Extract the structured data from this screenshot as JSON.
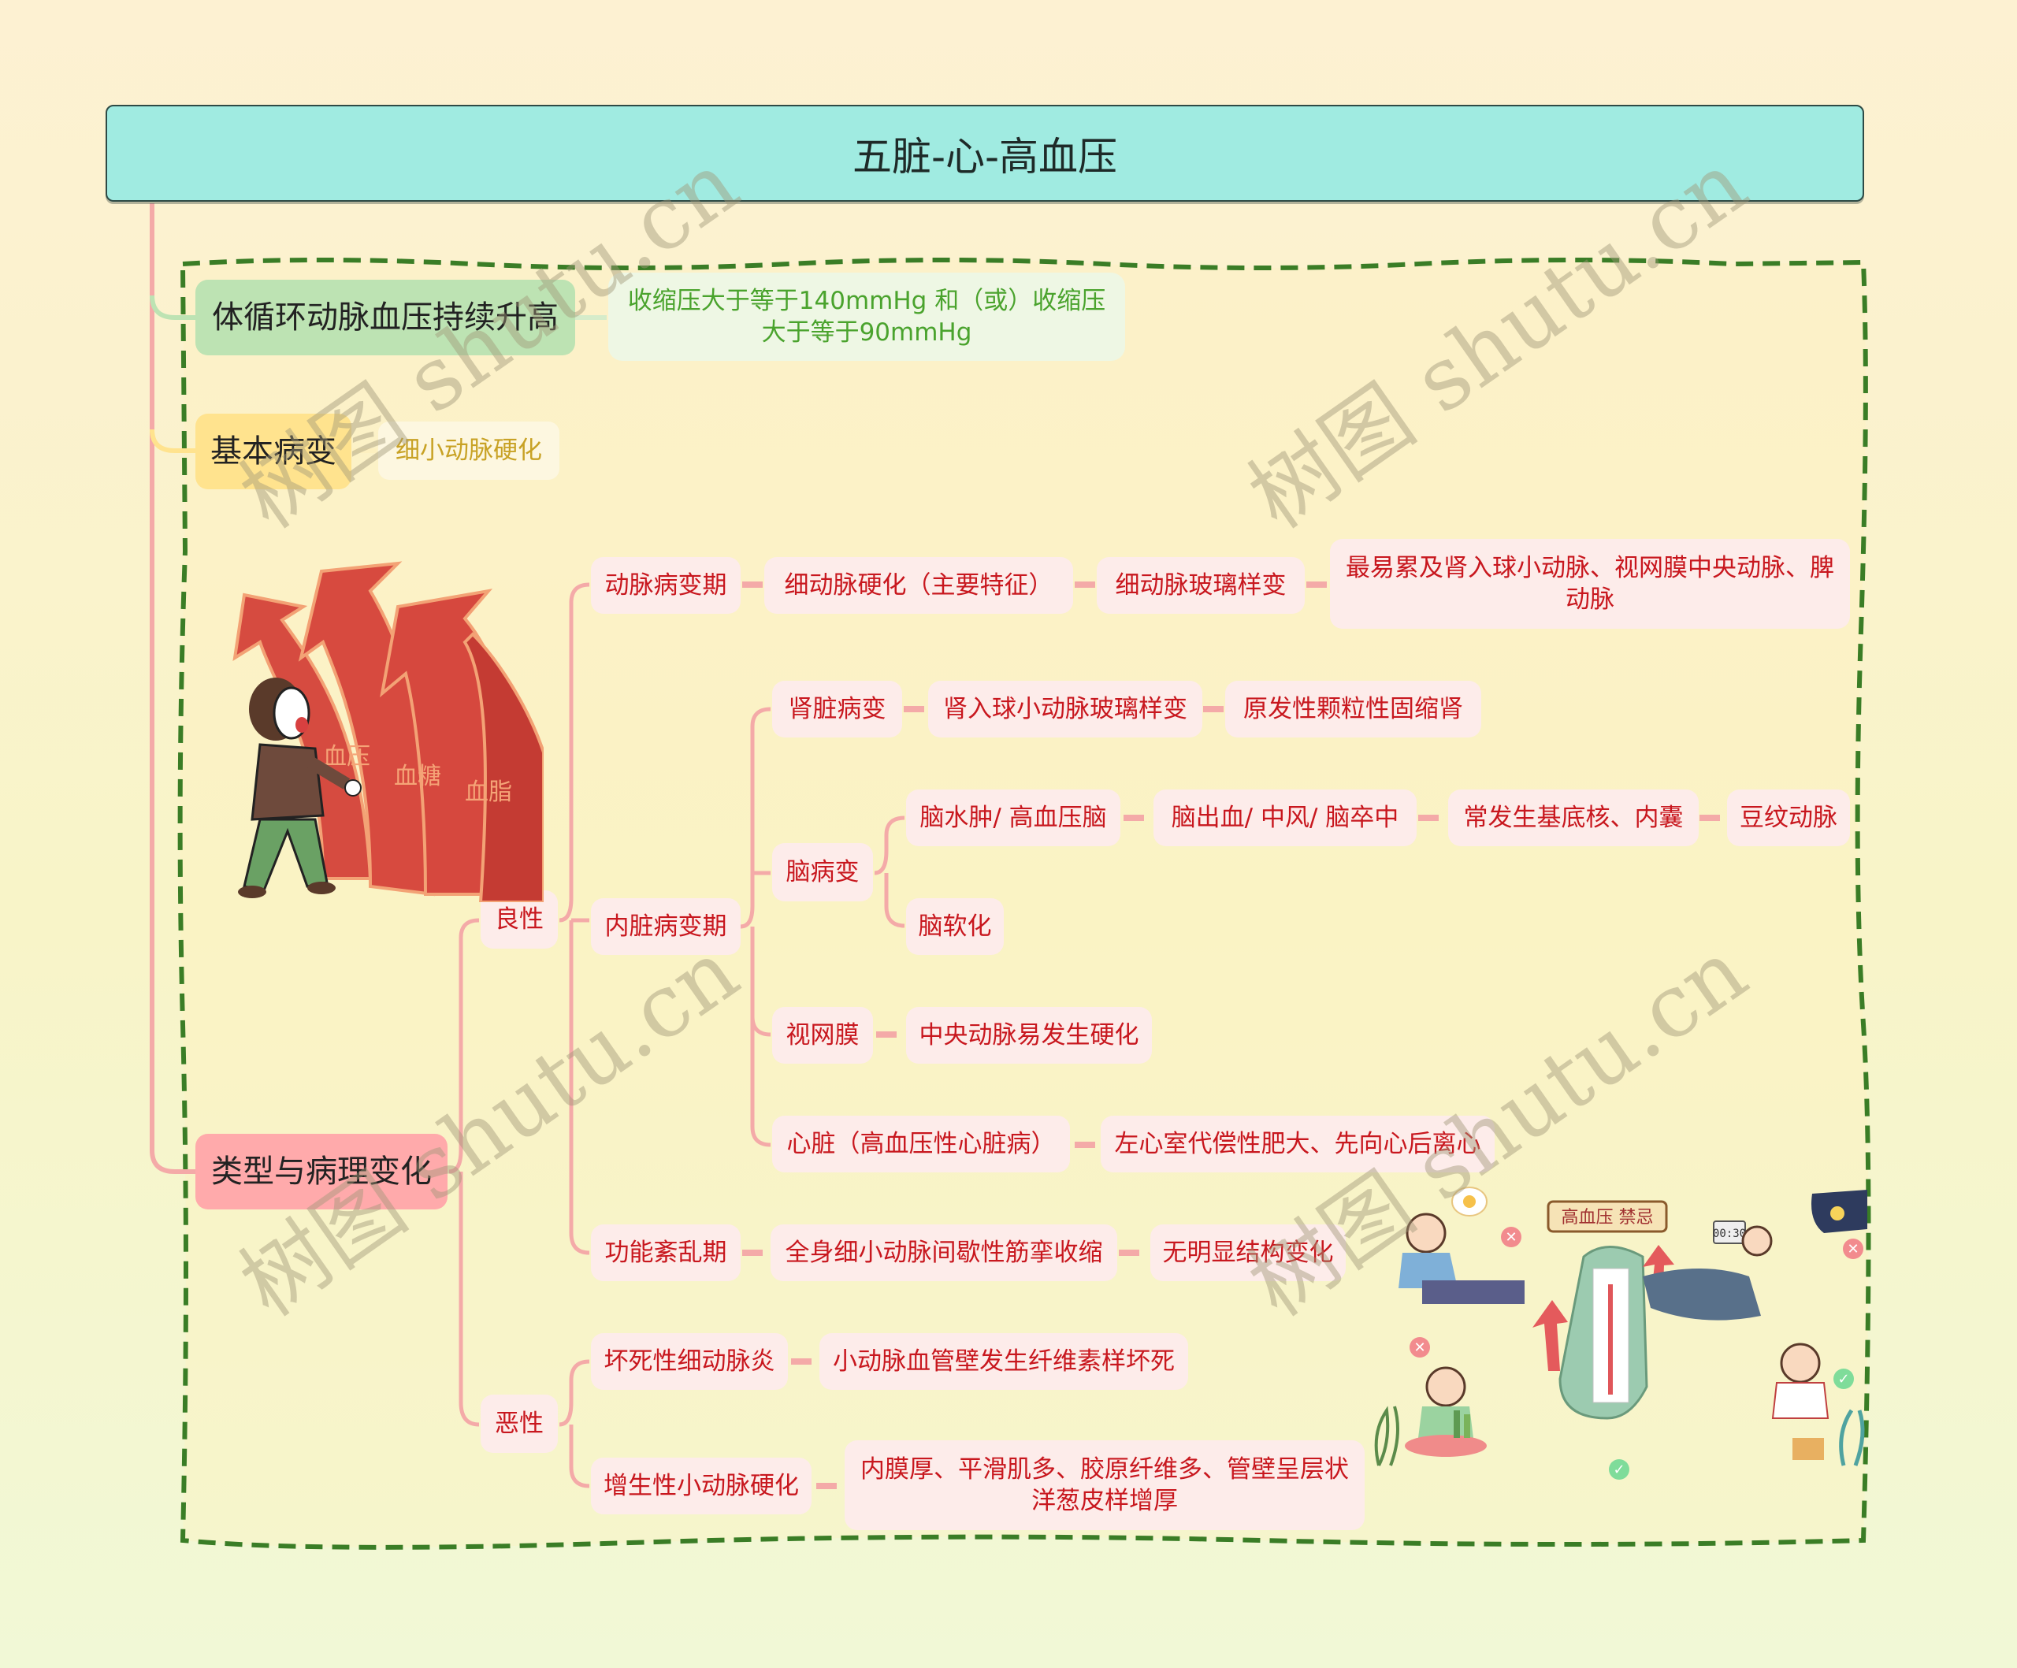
{
  "title": "五脏-心-高血压",
  "branches": {
    "definition": {
      "label": "体循环动脉血压持续升高",
      "detail_line1": "收缩压大于等于140mmHg 和（或）收缩压",
      "detail_line2": "大于等于90mmHg"
    },
    "basic_lesion": {
      "label": "基本病变",
      "detail": "细小动脉硬化"
    },
    "types": {
      "label": "类型与病理变化",
      "benign": {
        "label": "良性",
        "stages": {
          "arterial": {
            "label": "动脉病变期",
            "chain": [
              "细动脉硬化（主要特征）",
              "细动脉玻璃样变"
            ],
            "end_line1": "最易累及肾入球小动脉、视网膜中央动脉、脾",
            "end_line2": "动脉"
          },
          "visceral": {
            "label": "内脏病变期",
            "kidney": {
              "label": "肾脏病变",
              "chain": [
                "肾入球小动脉玻璃样变",
                "原发性颗粒性固缩肾"
              ]
            },
            "brain": {
              "label": "脑病变",
              "edema": {
                "label": "脑水肿/ 高血压脑",
                "chain": [
                  "脑出血/ 中风/ 脑卒中",
                  "常发生基底核、内囊",
                  "豆纹动脉"
                ]
              },
              "softening": {
                "label": "脑软化"
              }
            },
            "retina": {
              "label": "视网膜",
              "detail": "中央动脉易发生硬化"
            },
            "heart": {
              "label": "心脏（高血压性心脏病）",
              "detail": "左心室代偿性肥大、先向心后离心"
            }
          },
          "functional": {
            "label": "功能紊乱期",
            "chain": [
              "全身细小动脉间歇性筋挛收缩",
              "无明显结构变化"
            ]
          }
        }
      },
      "malignant": {
        "label": "恶性",
        "necrotizing": {
          "label": "坏死性细动脉炎",
          "detail": "小动脉血管壁发生纤维素样坏死"
        },
        "hyperplastic": {
          "label": "增生性小动脉硬化",
          "detail_line1": "内膜厚、平滑肌多、胶原纤维多、管壁呈层状",
          "detail_line2": "洋葱皮样增厚"
        }
      }
    }
  },
  "illustrations": {
    "arrows": {
      "labels": [
        "血压",
        "血糖",
        "血脂"
      ]
    },
    "taboos": {
      "sign": "高血压 禁忌",
      "clock": "00:30"
    }
  },
  "watermark": "树图 shutu.cn",
  "colors": {
    "root": "#a0ebe1",
    "green_branch": "#bde3b3",
    "yellow_branch": "#ffe38e",
    "pink_branch": "#ffaaab",
    "leaf_text_red": "#c8171e",
    "leaf_text_green": "#4aa32d",
    "leaf_text_yellow": "#c8a225",
    "frame_dash": "#3a7d26",
    "connector": "#f4aaa8"
  }
}
